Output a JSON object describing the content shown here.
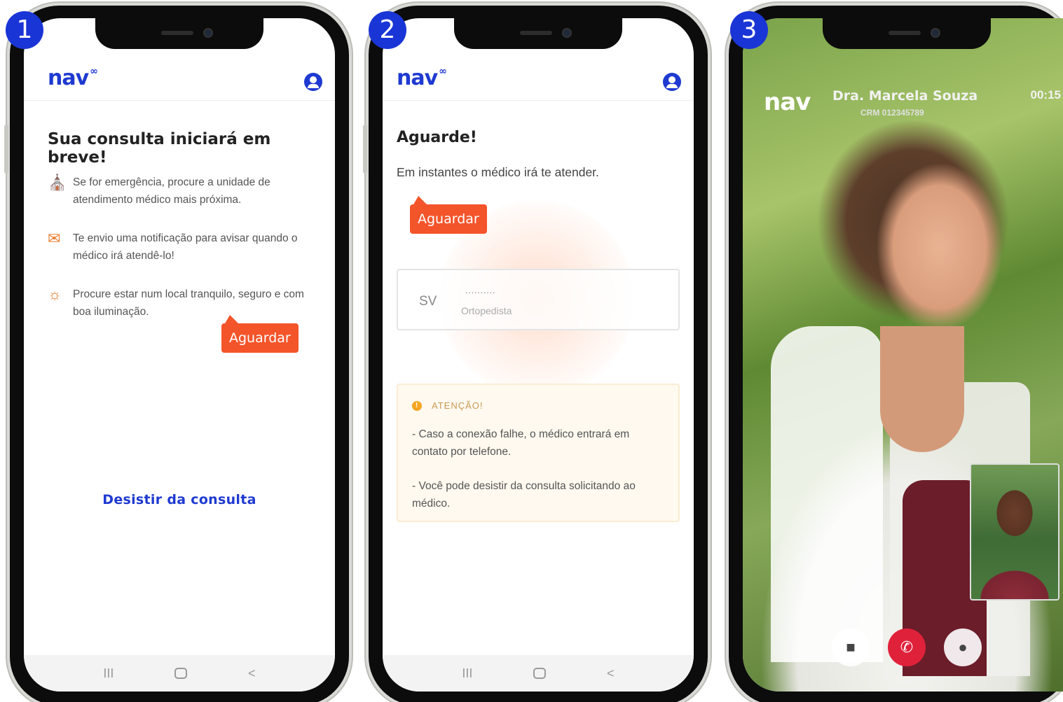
{
  "steps": [
    "1",
    "2",
    "3"
  ],
  "brand": {
    "logo_text": "nav",
    "logo_suffix": "∞",
    "primary_color": "#1f3ad1",
    "accent_color": "#f4542a"
  },
  "screen1": {
    "title": "Sua consulta iniciará em breve!",
    "items": [
      {
        "icon": "hospital-icon",
        "text": "Se for emergência, procure  a unidade de atendimento médico mais próxima."
      },
      {
        "icon": "chat-icon",
        "text": "Te envio uma notificação para avisar quando o médico irá  atendê-lo!"
      },
      {
        "icon": "sun-icon",
        "text": "Procure estar num local tranquilo, seguro e com boa iluminação."
      }
    ],
    "tooltip": "Aguardar",
    "cancel_link": "Desistir da consulta",
    "navbar": {
      "recents": "III",
      "back": "<"
    }
  },
  "screen2": {
    "title": "Aguarde!",
    "subtitle": "Em instantes o médico irá te atender.",
    "tooltip": "Aguardar",
    "doctor": {
      "initials": "SV",
      "name": "..........",
      "specialty": "Ortopedista"
    },
    "warning": {
      "heading": "ATENÇÃO!",
      "line1": "- Caso a conexão falhe, o médico entrará em contato por telefone.",
      "line2": "- Você pode desistir da consulta solicitando ao médico."
    },
    "navbar": {
      "recents": "III",
      "back": "<"
    }
  },
  "screen3": {
    "logo_text": "nav",
    "doctor_name": "Dra. Marcela Souza",
    "crm": "CRM 012345789",
    "timer": "00:15",
    "controls": {
      "video": "video-camera-icon",
      "end_call": "end-call-icon",
      "mic": "microphone-icon"
    }
  }
}
